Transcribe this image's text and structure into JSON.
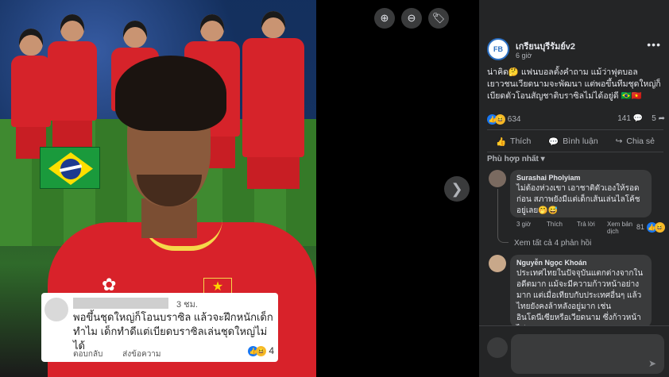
{
  "viewer": {
    "icons": [
      "zoom-in-icon",
      "zoom-out-icon",
      "tag-icon"
    ],
    "next_icon": "chevron-right-icon",
    "image": {
      "comment_card": {
        "time": "3 ชม.",
        "text": "พอขึ้นชุดใหญ่ก็โอนบราซิล แล้วจะฝึกหนักเด็กทำไม เด็กทำดีแต่เบียดบราซิลเล่นชุดใหญ่ไม่ได้",
        "reply_label": "ตอบกลับ",
        "send_label": "ส่งข้อความ",
        "reaction_count": "4"
      }
    }
  },
  "post": {
    "page_name": "เกรียนบุรีรัมย์v2",
    "time": "6 giờ",
    "text": "น่าคิด🤔 แฟนบอลตั้งคำถาม แม้ว่าฟุตบอลเยาวชนเวียดนามจะพัฒนา แต่พอขึ้นทีมชุดใหญ่ก็เบียดตัวโอนสัญชาติบราซิลไม่ได้อยู่ดี 🇧🇷🇻🇳",
    "reaction_count": "634",
    "comment_count": "141",
    "share_count": "5",
    "actions": {
      "like": "Thích",
      "comment": "Bình luận",
      "share": "Chia sẻ"
    },
    "sort_label": "Phù hợp nhất"
  },
  "comments": [
    {
      "name": "Surashai Pholyiam",
      "text": "ไม่ต้องห่วงเขา เอาชาติตัวเองให้รอดก่อน สภาพยังมีแต่เด็กเส้นเล่นไลโค้ชอยู่เลย🤭😅",
      "time": "3 giờ",
      "like": "Thích",
      "reply": "Trả lời",
      "translate": "Xem bản dịch",
      "reaction_count": "81"
    },
    {
      "name": "Nguyễn Ngọc Khoán",
      "text": "ประเทศไทยในปัจจุบันแตกต่างจากในอดีตมาก แม้จะมีความก้าวหน้าอย่างมาก แต่เมื่อเทียบกับประเทศอื่นๆ แล้ว ไทยยังคงล้าหลังอยู่มาก เช่น อินโดนีเซียหรือเวียดนาม ซึ่งก้าวหน้าไปมาก"
    }
  ],
  "see_more_replies": "Xem tất cả 4 phản hồi",
  "colors": {
    "panel_bg": "#242526",
    "bubble_bg": "#3a3b3c",
    "like_blue": "#1877f2",
    "jersey_red": "#d8222a"
  }
}
